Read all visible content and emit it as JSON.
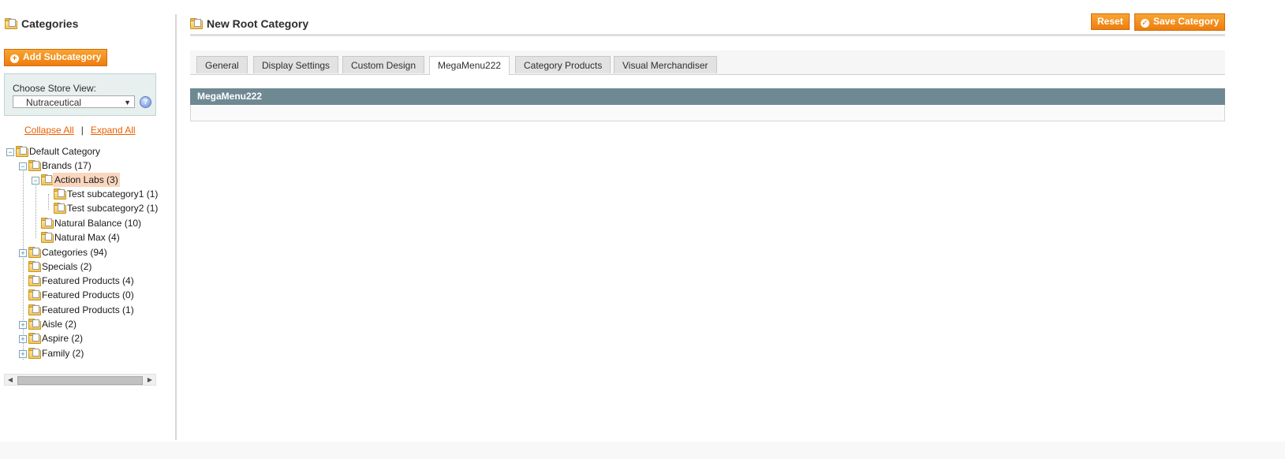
{
  "sidebar": {
    "title": "Categories",
    "add_subcategory_label": "Add Subcategory",
    "store_view": {
      "label": "Choose Store View:",
      "selected": "Nutraceutical"
    },
    "collapse_all": "Collapse All",
    "separator": "|",
    "expand_all": "Expand All",
    "tree": [
      {
        "label": "Default Category",
        "toggle": "minus"
      },
      {
        "label": "Brands (17)",
        "toggle": "minus"
      },
      {
        "label": "Action Labs (3)",
        "toggle": "minus",
        "selected": true
      },
      {
        "label": "Test subcategory1 (1)"
      },
      {
        "label": "Test subcategory2 (1)"
      },
      {
        "label": "Natural Balance (10)"
      },
      {
        "label": "Natural Max (4)"
      },
      {
        "label": "Categories (94)",
        "toggle": "plus"
      },
      {
        "label": "Specials (2)"
      },
      {
        "label": "Featured Products (4)"
      },
      {
        "label": "Featured Products (0)"
      },
      {
        "label": "Featured Products (1)"
      },
      {
        "label": "Aisle (2)",
        "toggle": "plus"
      },
      {
        "label": "Aspire (2)",
        "toggle": "plus"
      },
      {
        "label": "Family (2)",
        "toggle": "plus"
      }
    ]
  },
  "header": {
    "title": "New Root Category",
    "reset_label": "Reset",
    "save_label": "Save Category"
  },
  "tabs": [
    {
      "label": "General"
    },
    {
      "label": "Display Settings"
    },
    {
      "label": "Custom Design"
    },
    {
      "label": "MegaMenu222",
      "active": true
    },
    {
      "label": "Category Products"
    },
    {
      "label": "Visual Merchandiser"
    }
  ],
  "section": {
    "title": "MegaMenu222"
  },
  "colors": {
    "accent": "#ee7d0e",
    "section_header": "#6f8992",
    "selected_node": "#fad6bf"
  }
}
